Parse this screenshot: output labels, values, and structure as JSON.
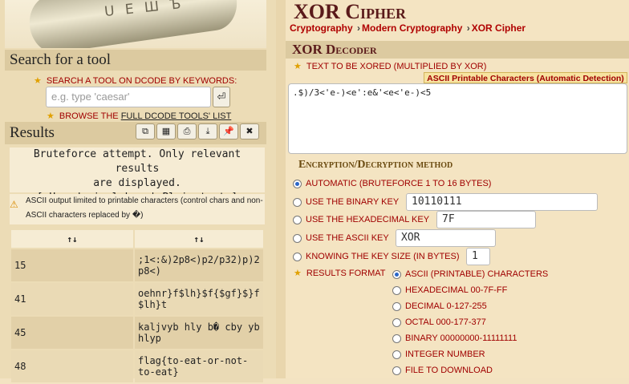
{
  "sidebar": {
    "logo_letters": "U Е Ш Ъ",
    "search_heading": "Search for a tool",
    "search_keywords_label": "SEARCH A TOOL ON DCODE BY KEYWORDS:",
    "search_placeholder": "e.g. type 'caesar'",
    "browse_prefix": "BROWSE THE",
    "browse_link": "FULL DCODE TOOLS' LIST",
    "results_heading": "Results",
    "results_buttons": [
      "copy-icon",
      "calc-icon",
      "print-icon",
      "download-icon",
      "pin-icon",
      "close-icon"
    ],
    "results_intro_line1": "Bruteforce attempt. Only relevant results",
    "results_intro_line2": "are displayed.",
    "results_intro_line3": "[ Hexadecimal key | Plain text ]",
    "warning_text_1": "ASCII output limited to printable characters (control chars and non-",
    "warning_text_2": "ASCII characters replaced by �)",
    "sort_label_1": "↑↓",
    "sort_label_2": "↑↓",
    "rows": [
      {
        "key": "15",
        "text_1": ";1<:&)2p8<)p2/p32)p)2",
        "text_2": "p8<)"
      },
      {
        "key": "41",
        "text_1": "oehnr}f$lh}$f{$gf}$}f",
        "text_2": "$lh}t"
      },
      {
        "key": "45",
        "text_1": "kaljvyb hly b� cby yb",
        "text_2": "hlyp"
      },
      {
        "key": "48",
        "text_1": "flag{to-eat-or-not-",
        "text_2": "to-eat}"
      }
    ]
  },
  "main": {
    "title": "XOR Cipher",
    "breadcrumb": [
      "Cryptography",
      "Modern Cryptography",
      "XOR Cipher"
    ],
    "section_title": "XOR Decoder",
    "text_label": "TEXT TO BE XORED (MULTIPLIED BY XOR)",
    "detected_badge": "ASCII Printable Characters (Automatic Detection)",
    "text_value": ".$)/3<'e-)<e':e&'<e<'e-)<5",
    "method_title": "Encryption/Decryption method",
    "methods": [
      {
        "label": "AUTOMATIC (BRUTEFORCE 1 TO 16 BYTES)",
        "selected": true
      },
      {
        "label": "USE THE BINARY KEY",
        "value": "10110111"
      },
      {
        "label": "USE THE HEXADECIMAL KEY",
        "value": "7F"
      },
      {
        "label": "USE THE ASCII KEY",
        "value": "XOR"
      },
      {
        "label": "KNOWING THE KEY SIZE (IN BYTES)",
        "value": "1"
      }
    ],
    "results_format_label": "RESULTS FORMAT",
    "formats": [
      {
        "label": "ASCII (PRINTABLE) CHARACTERS",
        "selected": true
      },
      {
        "label": "HEXADECIMAL 00-7F-FF"
      },
      {
        "label": "DECIMAL 0-127-255"
      },
      {
        "label": "OCTAL 000-177-377"
      },
      {
        "label": "BINARY 00000000-11111111"
      },
      {
        "label": "INTEGER NUMBER"
      },
      {
        "label": "FILE TO DOWNLOAD"
      }
    ]
  },
  "colors": {
    "accent": "#a00000",
    "panel": "#dccaa0",
    "background": "#f3e3c2"
  }
}
